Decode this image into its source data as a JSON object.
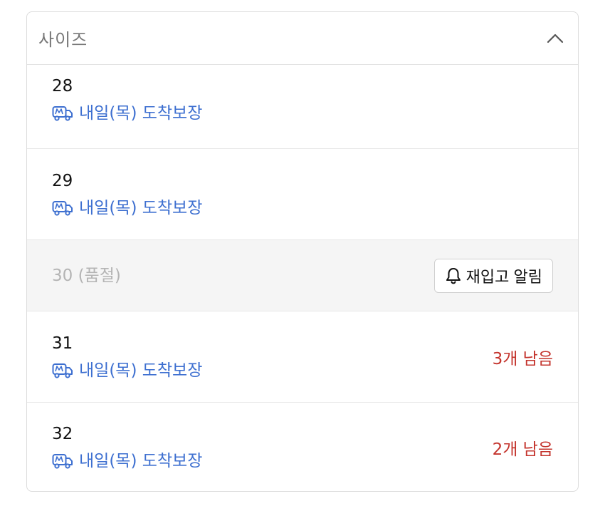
{
  "dropdown": {
    "title": "사이즈",
    "expanded": true
  },
  "options": [
    {
      "size": "28",
      "delivery": "내일(목) 도착보장",
      "stock": ""
    },
    {
      "size": "29",
      "delivery": "내일(목) 도착보장",
      "stock": ""
    },
    {
      "size": "30 (품절)",
      "restock_label": "재입고 알림"
    },
    {
      "size": "31",
      "delivery": "내일(목) 도착보장",
      "stock": "3개 남음"
    },
    {
      "size": "32",
      "delivery": "내일(목) 도착보장",
      "stock": "2개 남음"
    }
  ],
  "colors": {
    "delivery": "#3d6fd0",
    "stock_warning": "#c4342d",
    "soldout_bg": "#f5f5f5"
  },
  "icons": {
    "header": "chevron-up-icon",
    "delivery": "delivery-truck-icon",
    "restock": "bell-icon"
  }
}
